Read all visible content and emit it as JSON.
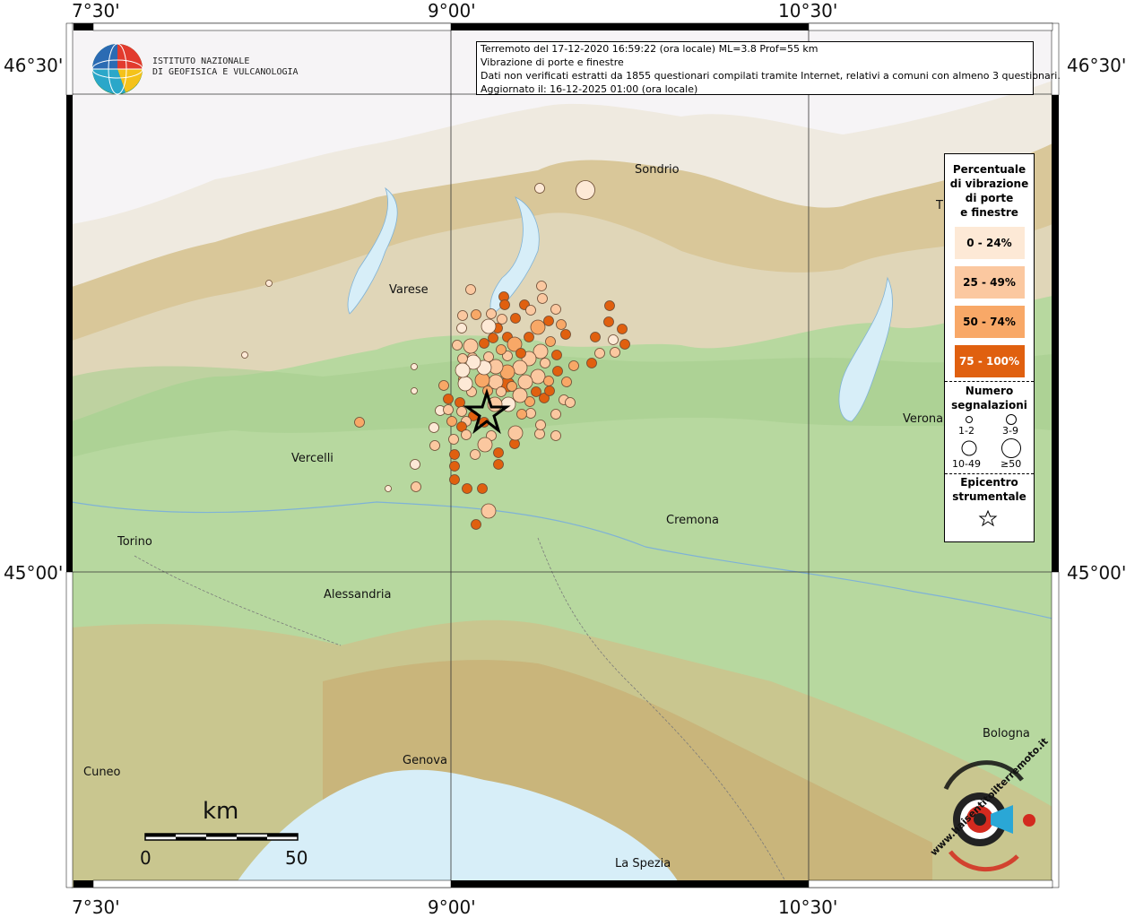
{
  "header": {
    "line1": "Terremoto del 17-12-2020 16:59:22 (ora locale) ML=3.8 Prof=55 km",
    "line2": "Vibrazione di porte e finestre",
    "line3": "Dati non verificati estratti da 1855 questionari compilati tramite Internet, relativi a comuni con almeno 3 questionari.",
    "line4": "Aggiornato il: 16-12-2025 01:00 (ora locale)"
  },
  "logo": {
    "line1": "ISTITUTO NAZIONALE",
    "line2": "DI GEOFISICA E VULCANOLOGIA"
  },
  "coords": {
    "lon_730": "7°30'",
    "lon_900": "9°00'",
    "lon_1030": "10°30'",
    "lat_4630": "46°30'",
    "lat_4500": "45°00'"
  },
  "cities": [
    {
      "name": "Sondrio"
    },
    {
      "name": "Varese"
    },
    {
      "name": "Vercelli"
    },
    {
      "name": "Torino"
    },
    {
      "name": "Alessandria"
    },
    {
      "name": "Cremona"
    },
    {
      "name": "Verona"
    },
    {
      "name": "Genova"
    },
    {
      "name": "Cuneo"
    },
    {
      "name": "Bologna"
    },
    {
      "name": "La Spezia"
    },
    {
      "name": "T"
    }
  ],
  "legend": {
    "title1": "Percentuale",
    "title2": "di vibrazione",
    "title3": "di porte",
    "title4": "e finestre",
    "classes": [
      {
        "label": "0 - 24%",
        "color": "#fde9d6"
      },
      {
        "label": "25 - 49%",
        "color": "#fbc8a0"
      },
      {
        "label": "50 - 74%",
        "color": "#f8a867"
      },
      {
        "label": "75 - 100%",
        "color": "#e0600f"
      }
    ],
    "count_title1": "Numero",
    "count_title2": "segnalazioni",
    "size1": "1-2",
    "size2": "3-9",
    "size3": "10-49",
    "size4": "≥50",
    "epi_title1": "Epicentro",
    "epi_title2": "strumentale"
  },
  "scale": {
    "unit": "km",
    "min": "0",
    "max": "50"
  },
  "hsit_logo_text": "www.haisentitoilterremoto.it"
}
